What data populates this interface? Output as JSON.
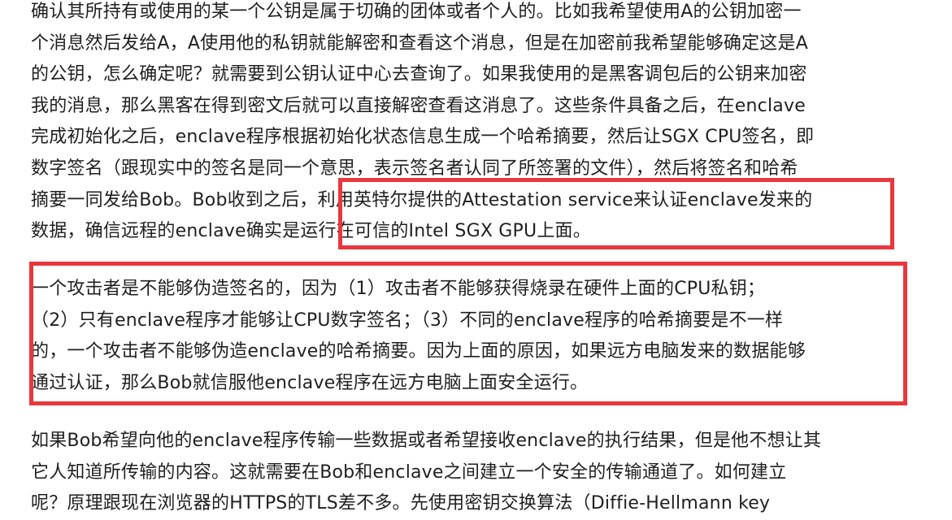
{
  "article": {
    "paragraphs": [
      {
        "lines": [
          "确认其所持有或使用的某一个公钥是属于切确的团体或者个人的。比如我希望使用A的公钥加密一",
          "个消息然后发给A，A使用他的私钥就能解密和查看这个消息，但是在加密前我希望能够确定这是A",
          "的公钥，怎么确定呢？就需要到公钥认证中心去查询了。如果我使用的是黑客调包后的公钥来加密",
          "我的消息，那么黑客在得到密文后就可以直接解密查看这消息了。这些条件具备之后，在enclave",
          "完成初始化之后，enclave程序根据初始化状态信息生成一个哈希摘要，然后让SGX CPU签名，即",
          "数字签名（跟现实中的签名是同一个意思，表示签名者认同了所签署的文件），然后将签名和哈希",
          "摘要一同发给Bob。Bob收到之后，利用英特尔提供的Attestation service来认证enclave发来的",
          "数据，确信远程的enclave确实是运行在可信的Intel SGX GPU上面。"
        ]
      },
      {
        "lines": [
          "一个攻击者是不能够伪造签名的，因为（1）攻击者不能够获得烧录在硬件上面的CPU私钥；",
          "（2）只有enclave程序才能够让CPU数字签名；（3）不同的enclave程序的哈希摘要是不一样",
          "的，一个攻击者不能够伪造enclave的哈希摘要。因为上面的原因，如果远方电脑发来的数据能够",
          "通过认证，那么Bob就信服他enclave程序在远方电脑上面安全运行。"
        ]
      },
      {
        "lines": [
          "如果Bob希望向他的enclave程序传输一些数据或者希望接收enclave的执行结果，但是他不想让其",
          "它人知道所传输的内容。这就需要在Bob和enclave之间建立一个安全的传输通道了。如何建立",
          "呢？原理跟现在浏览器的HTTPS的TLS差不多。先使用密钥交换算法（Diffie-Hellmann key"
        ]
      }
    ]
  },
  "highlight_color": "#e8383d"
}
